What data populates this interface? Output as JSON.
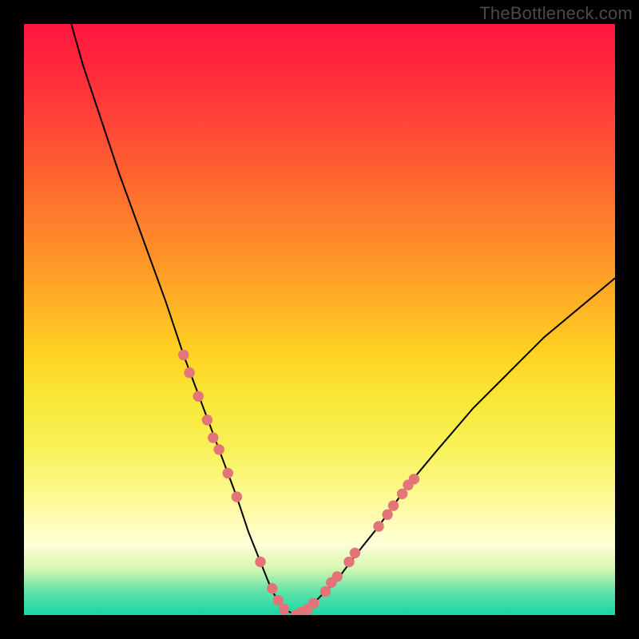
{
  "watermark": "TheBottleneck.com",
  "colors": {
    "frame_bg": "#000000",
    "curve_stroke": "#000000",
    "marker_fill": "#e37477",
    "gradient_top": "#ff163e",
    "gradient_bottom": "#1ad6a6"
  },
  "chart_data": {
    "type": "line",
    "title": "",
    "xlabel": "",
    "ylabel": "",
    "xlim": [
      0,
      100
    ],
    "ylim": [
      0,
      100
    ],
    "grid": false,
    "legend": false,
    "series": [
      {
        "name": "bottleneck-curve",
        "description": "V-shaped curve; y ~ bottleneck %, lower is better; minimum ~0 around x≈44",
        "x": [
          8,
          10,
          13,
          16,
          20,
          24,
          27,
          30,
          33,
          36,
          38,
          40,
          42,
          44,
          46,
          48,
          50,
          53,
          56,
          60,
          65,
          70,
          76,
          82,
          88,
          94,
          100
        ],
        "y": [
          100,
          93,
          84,
          75,
          64,
          53,
          44,
          36,
          28,
          20,
          14,
          9,
          4,
          1,
          0,
          1,
          3,
          6,
          10,
          15,
          22,
          28,
          35,
          41,
          47,
          52,
          57
        ]
      }
    ],
    "markers": {
      "name": "highlighted-points",
      "fill": "#e37477",
      "radius_pct": 0.9,
      "points": [
        {
          "x": 27,
          "y": 44
        },
        {
          "x": 28,
          "y": 41
        },
        {
          "x": 29.5,
          "y": 37
        },
        {
          "x": 31,
          "y": 33
        },
        {
          "x": 32,
          "y": 30
        },
        {
          "x": 33,
          "y": 28
        },
        {
          "x": 34.5,
          "y": 24
        },
        {
          "x": 36,
          "y": 20
        },
        {
          "x": 40,
          "y": 9
        },
        {
          "x": 42,
          "y": 4.5
        },
        {
          "x": 43,
          "y": 2.5
        },
        {
          "x": 44,
          "y": 1
        },
        {
          "x": 46,
          "y": 0
        },
        {
          "x": 47,
          "y": 0.5
        },
        {
          "x": 48,
          "y": 1
        },
        {
          "x": 49,
          "y": 2
        },
        {
          "x": 51,
          "y": 4
        },
        {
          "x": 52,
          "y": 5.5
        },
        {
          "x": 53,
          "y": 6.5
        },
        {
          "x": 55,
          "y": 9
        },
        {
          "x": 56,
          "y": 10.5
        },
        {
          "x": 60,
          "y": 15
        },
        {
          "x": 61.5,
          "y": 17
        },
        {
          "x": 62.5,
          "y": 18.5
        },
        {
          "x": 64,
          "y": 20.5
        },
        {
          "x": 65,
          "y": 22
        },
        {
          "x": 66,
          "y": 23
        }
      ]
    }
  }
}
